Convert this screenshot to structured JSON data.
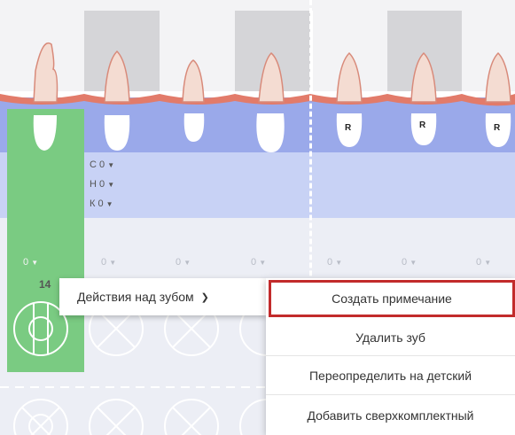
{
  "teeth": {
    "r_marks": [
      "R",
      "R",
      "R"
    ]
  },
  "codes": {
    "c": "С 0",
    "h": "Н 0",
    "k": "К 0"
  },
  "selectors": {
    "values": [
      "0",
      "0",
      "0",
      "0",
      "0",
      "0",
      "0"
    ]
  },
  "tooth_number": "14",
  "actions_menu": {
    "label": "Действия над зубом",
    "chevron": "❯"
  },
  "context_menu": {
    "items": [
      "Создать примечание",
      "Удалить зуб",
      "Переопределить на детский",
      "Добавить сверхкомплектный"
    ]
  },
  "colors": {
    "selected_column": "#7acb82",
    "gum": "#e27b6a",
    "root_band": "#9aa9ea",
    "codes_band": "#c8d2f5",
    "grey_column": "#d5d5d8",
    "highlight_border": "#c22b2b"
  }
}
